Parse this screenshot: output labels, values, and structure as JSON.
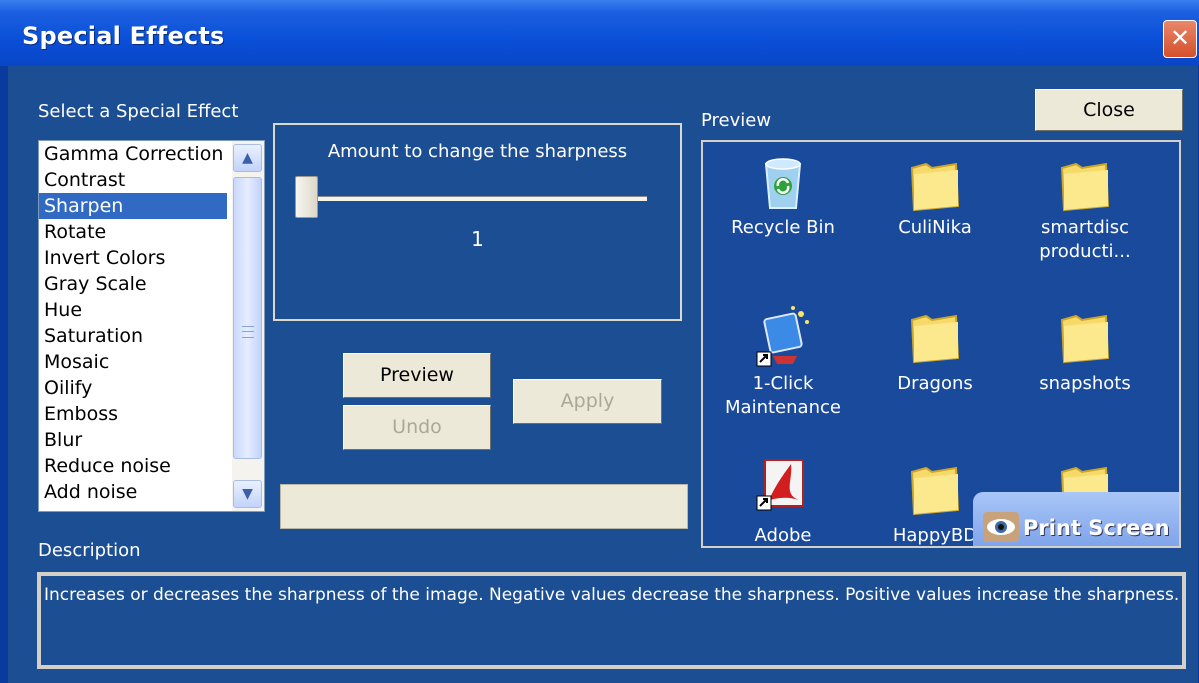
{
  "window": {
    "title": "Special Effects",
    "close_glyph": "✕"
  },
  "effects": {
    "label": "Select a Special Effect",
    "items": [
      "Gamma Correction",
      "Contrast",
      "Sharpen",
      "Rotate",
      "Invert Colors",
      "Gray Scale",
      "Hue",
      "Saturation",
      "Mosaic",
      "Oilify",
      "Emboss",
      "Blur",
      "Reduce noise",
      "Add noise"
    ],
    "selected": "Sharpen"
  },
  "amount": {
    "label": "Amount to change the sharpness",
    "value": "1"
  },
  "buttons": {
    "preview": "Preview",
    "undo": "Undo",
    "apply": "Apply",
    "close": "Close"
  },
  "preview": {
    "label": "Preview",
    "icons": [
      {
        "label": "Recycle Bin",
        "icon": "recycle-bin-icon"
      },
      {
        "label": "CuliNika",
        "icon": "folder-icon"
      },
      {
        "label": "smartdisc producti...",
        "icon": "folder-icon"
      },
      {
        "label": "1-Click Maintenance",
        "icon": "maintenance-icon"
      },
      {
        "label": "Dragons",
        "icon": "folder-icon"
      },
      {
        "label": "snapshots",
        "icon": "folder-icon"
      },
      {
        "label": "Adobe Reader",
        "icon": "adobe-reader-icon"
      },
      {
        "label": "HappyBD",
        "icon": "folder-icon"
      },
      {
        "label": "",
        "icon": "folder-icon"
      }
    ],
    "print_screen": "Print Screen"
  },
  "description": {
    "label": "Description",
    "text": "Increases or decreases the sharpness of the image.  Negative values decrease the sharpness.  Positive values increase the sharpness."
  }
}
